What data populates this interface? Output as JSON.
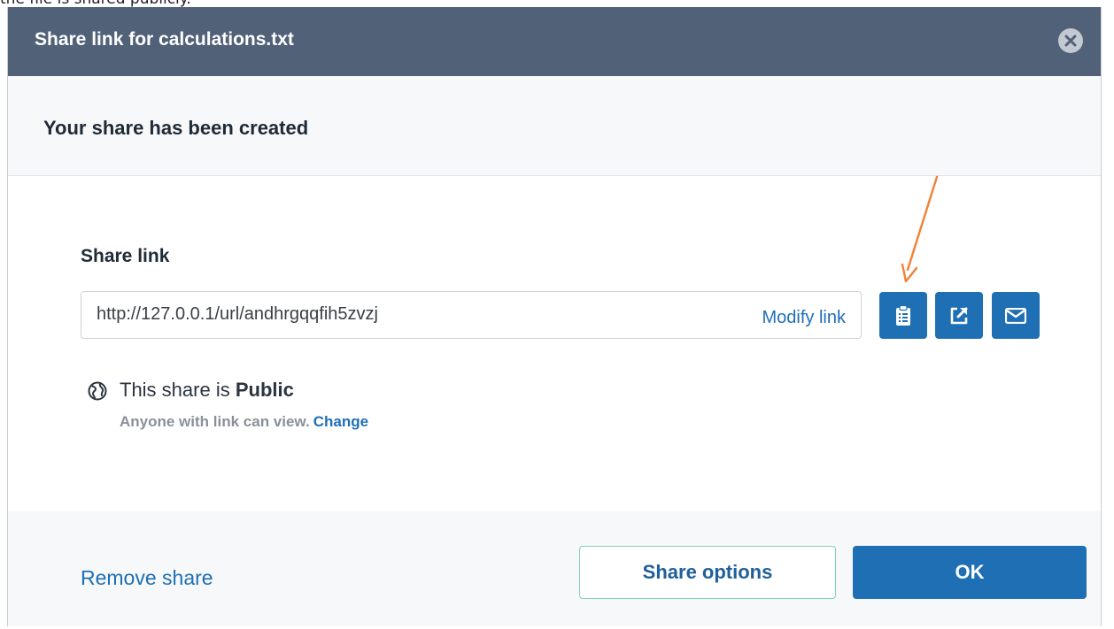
{
  "background": {
    "caption": "the file is shared publicly."
  },
  "dialog": {
    "title": "Share link for calculations.txt",
    "subheader": "Your share has been created",
    "share_link_label": "Share link",
    "link_value": "http://127.0.0.1/url/andhrgqqfih5zvzj",
    "modify_link_label": "Modify link",
    "icons": {
      "close": "close-icon",
      "copy": "clipboard-icon",
      "open": "external-link-icon",
      "email": "envelope-icon",
      "visibility": "globe-icon"
    },
    "visibility": {
      "prefix": "This share is ",
      "state": "Public",
      "description": "Anyone with link can view.",
      "change_label": "Change"
    },
    "footer": {
      "remove_label": "Remove share",
      "options_label": "Share options",
      "ok_label": "OK"
    }
  },
  "colors": {
    "titlebar": "#516178",
    "accent": "#1f6fb5",
    "annotation_arrow": "#f0843c"
  }
}
